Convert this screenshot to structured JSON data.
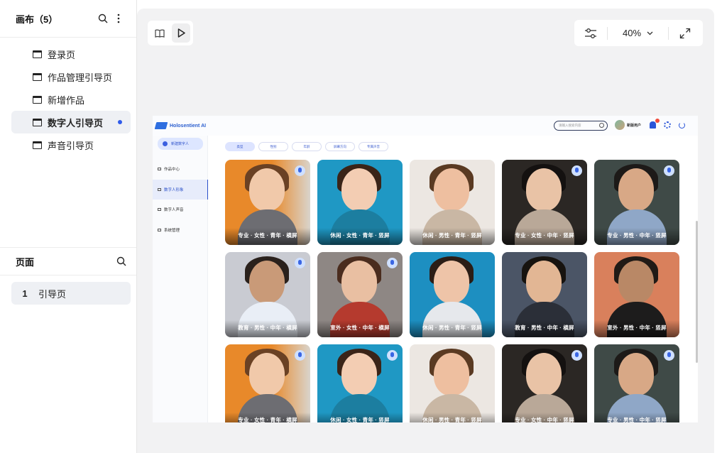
{
  "left_panel": {
    "canvas_title": "画布（5）",
    "canvases": [
      {
        "label": "登录页"
      },
      {
        "label": "作品管理引导页"
      },
      {
        "label": "新增作品"
      },
      {
        "label": "数字人引导页"
      },
      {
        "label": "声音引导页"
      }
    ],
    "pages_title": "页面",
    "pages": [
      {
        "num": "1",
        "label": "引导页"
      }
    ]
  },
  "toolbar": {
    "zoom": "40%"
  },
  "app": {
    "brand": "Holosentient AI",
    "search_placeholder": "请输入搜索内容",
    "user_name": "新版用户",
    "new_button": "新建数字人",
    "side_items": [
      {
        "label": "作品中心"
      },
      {
        "label": "数字人形象"
      },
      {
        "label": "数字人声音"
      },
      {
        "label": "系统管理"
      }
    ],
    "filters": [
      "类型",
      "性别",
      "年龄",
      "屏幕方向",
      "专属声音"
    ],
    "cards": [
      {
        "label": "专业 · 女性 · 青年 · 横屏"
      },
      {
        "label": "休闲 · 女性 · 青年 · 竖屏"
      },
      {
        "label": "休闲 · 男性 · 青年 · 竖屏"
      },
      {
        "label": "专业 · 女性 · 中年 · 竖屏"
      },
      {
        "label": "专业 · 男性 · 中年 · 竖屏"
      },
      {
        "label": "教育 · 男性 · 中年 · 横屏"
      },
      {
        "label": "室外 · 女性 · 中年 · 横屏"
      },
      {
        "label": "休闲 · 男性 · 青年 · 竖屏"
      },
      {
        "label": "教育 · 男性 · 中年 · 横屏"
      },
      {
        "label": "室外 · 男性 · 中年 · 竖屏"
      },
      {
        "label": "专业 · 女性 · 青年 · 横屏"
      },
      {
        "label": "休闲 · 女性 · 青年 · 竖屏"
      },
      {
        "label": "休闲 · 男性 · 青年 · 竖屏"
      },
      {
        "label": "专业 · 女性 · 中年 · 竖屏"
      },
      {
        "label": "专业 · 男性 · 中年 · 竖屏"
      }
    ]
  },
  "colors": {
    "accent": "#2f5bea",
    "canvas_bg": "#f2f2f3"
  }
}
